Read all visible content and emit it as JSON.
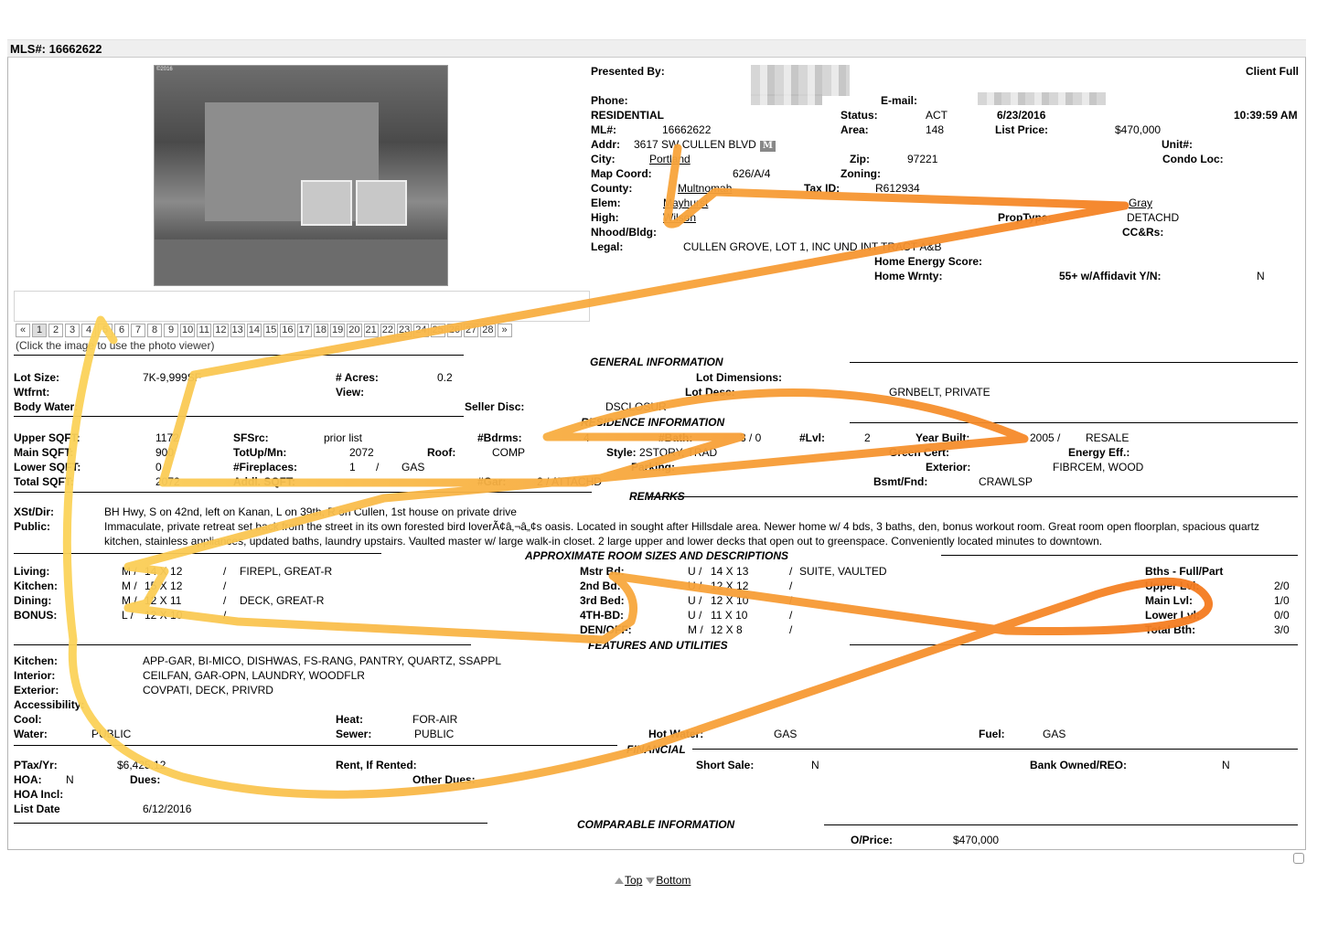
{
  "header": {
    "title": "MLS#: 16662622"
  },
  "photo": {
    "copyright": "©2016",
    "alt": "house-photo"
  },
  "pager": {
    "prev": "«",
    "pages": [
      "1",
      "2",
      "3",
      "4",
      "5",
      "6",
      "7",
      "8",
      "9",
      "10",
      "11",
      "12",
      "13",
      "14",
      "15",
      "16",
      "17",
      "18",
      "19",
      "20",
      "21",
      "22",
      "23",
      "24",
      "25",
      "26",
      "27",
      "28"
    ],
    "next": "»",
    "active": "1",
    "hint": "(Click the image to use the photo viewer)"
  },
  "agent": {
    "presented_by_label": "Presented By:",
    "phone_label": "Phone:",
    "email_label": "E-mail:",
    "report_type": "Client Full"
  },
  "listing": {
    "type": "RESIDENTIAL",
    "status_label": "Status:",
    "status": "ACT",
    "date": "6/23/2016",
    "time": "10:39:59 AM",
    "ml_label": "ML#:",
    "ml": "16662622",
    "area_label": "Area:",
    "area": "148",
    "list_price_label": "List Price:",
    "list_price": "$470,000",
    "addr_label": "Addr:",
    "addr": "3617 SW CULLEN BLVD",
    "map_badge": "M",
    "unit_label": "Unit#:",
    "city_label": "City:",
    "city": "Portland",
    "zip_label": "Zip:",
    "zip": "97221",
    "condo_label": "Condo Loc:",
    "map_coord_label": "Map Coord:",
    "map_coord": "626/A/4",
    "zoning_label": "Zoning:",
    "county_label": "County:",
    "county": "Multnomah",
    "tax_id_label": "Tax ID:",
    "tax_id": "R612934",
    "elem_label": "Elem:",
    "elem": "Mayhurst",
    "middle": "Gray",
    "high_label": "High:",
    "high": "Wilson",
    "proptype_label": "PropType:",
    "proptype": "DETACHD",
    "nhood_label": "Nhood/Bldg:",
    "ccrs_label": "CC&Rs:",
    "legal_label": "Legal:",
    "legal": "CULLEN GROVE, LOT 1, INC UND INT TRACT A&B",
    "energy_label": "Home Energy Score:",
    "wrnty_label": "Home Wrnty:",
    "affidavit_label": "55+ w/Affidavit Y/N:",
    "affidavit": "N"
  },
  "general": {
    "title": "GENERAL INFORMATION",
    "lot_size_label": "Lot Size:",
    "lot_size": "7K-9,999SF",
    "acres_label": "# Acres:",
    "acres": "0.2",
    "lot_dim_label": "Lot Dimensions:",
    "wtfrnt_label": "Wtfrnt:",
    "view_label": "View:",
    "lot_desc_label": "Lot Desc:",
    "lot_desc": "GRNBELT, PRIVATE",
    "body_water_label": "Body Water:",
    "seller_disc_label": "Seller Disc:",
    "seller_disc": "DSCLOSUR"
  },
  "residence": {
    "title": "RESIDENCE INFORMATION",
    "upper_label": "Upper SQFT:",
    "upper": "1172",
    "sfsrc_label": "SFSrc:",
    "sfsrc": "prior list",
    "bdrms_label": "#Bdrms:",
    "bdrms": "4",
    "bath_label": "#Bath:",
    "bath": "3 / 0",
    "lvl_label": "#Lvl:",
    "lvl": "2",
    "year_label": "Year Built:",
    "year": "2005 /",
    "year_type": "RESALE",
    "main_label": "Main SQFT:",
    "main": "900",
    "totupmn_label": "TotUp/Mn:",
    "totupmn": "2072",
    "roof_label": "Roof:",
    "roof": "COMP",
    "style_label": "Style:",
    "style": "2STORY, TRAD",
    "green_label": "Green Cert:",
    "energy_eff_label": "Energy Eff.:",
    "lower_label": "Lower SQFT:",
    "lower": "0",
    "fireplaces_label": "#Fireplaces:",
    "fireplaces": "1",
    "fireplaces_sep": "/",
    "fireplaces_type": "GAS",
    "parking_label": "Parking:",
    "exterior_label": "Exterior:",
    "exterior": "FIBRCEM, WOOD",
    "total_label": "Total SQFT:",
    "total": "2072",
    "addl_label": "Addl. SQFT:",
    "gar_label": "#Gar:",
    "gar": "2 / ATTACHD",
    "bsmt_label": "Bsmt/Fnd:",
    "bsmt": "CRAWLSP"
  },
  "remarks": {
    "title": "REMARKS",
    "xst_label": "XSt/Dir:",
    "xst": "BH Hwy, S on 42nd, left on Kanan, L on 39th, R on Cullen, 1st house on private drive",
    "public_label": "Public:",
    "public_line1": "Immaculate, private retreat set back from the street in its own forested bird loverÃ¢â‚¬â„¢s oasis. Located in sought after Hillsdale area. Newer home w/ 4 bds, 3 baths, den, bonus workout room. Great room open floorplan, spacious quartz",
    "public_line2": "kitchen, stainless appliances, updated baths, laundry upstairs. Vaulted master w/ large walk-in closet. 2 large upper and lower decks that open out to greenspace. Conveniently located minutes to downtown."
  },
  "rooms": {
    "title": "APPROXIMATE ROOM SIZES AND DESCRIPTIONS",
    "left": [
      {
        "name": "Living:",
        "lvl": "M /",
        "size": "14 X 12",
        "sep": "/",
        "desc": "FIREPL, GREAT-R"
      },
      {
        "name": "Kitchen:",
        "lvl": "M /",
        "size": "15 X 12",
        "sep": "/",
        "desc": ""
      },
      {
        "name": "Dining:",
        "lvl": "M /",
        "size": "12 X 11",
        "sep": "/",
        "desc": "DECK, GREAT-R"
      },
      {
        "name": "BONUS:",
        "lvl": "L /",
        "size": "12 X 10",
        "sep": "/",
        "desc": ""
      }
    ],
    "right": [
      {
        "name": "Mstr Bd:",
        "lvl": "U /",
        "size": "14 X 13",
        "sep": "/",
        "desc": "SUITE, VAULTED"
      },
      {
        "name": "2nd Bd:",
        "lvl": "U /",
        "size": "12 X 12",
        "sep": "/",
        "desc": ""
      },
      {
        "name": "3rd Bed:",
        "lvl": "U /",
        "size": "12 X 10",
        "sep": "/",
        "desc": ""
      },
      {
        "name": "4TH-BD:",
        "lvl": "U /",
        "size": "11 X 10",
        "sep": "/",
        "desc": ""
      },
      {
        "name": "DEN/OFF:",
        "lvl": "M /",
        "size": "12 X 8",
        "sep": "/",
        "desc": ""
      }
    ],
    "baths_title": "Bths - Full/Part",
    "baths": [
      {
        "name": "Upper Lvl:",
        "val": "2/0"
      },
      {
        "name": "Main Lvl:",
        "val": "1/0"
      },
      {
        "name": "Lower Lvl:",
        "val": "0/0"
      },
      {
        "name": "Total Bth:",
        "val": "3/0"
      }
    ]
  },
  "features": {
    "title": "FEATURES AND UTILITIES",
    "kitchen_label": "Kitchen:",
    "kitchen": "APP-GAR, BI-MICO, DISHWAS, FS-RANG, PANTRY, QUARTZ, SSAPPL",
    "interior_label": "Interior:",
    "interior": "CEILFAN, GAR-OPN, LAUNDRY, WOODFLR",
    "exterior_label": "Exterior:",
    "exterior": "COVPATI, DECK, PRIVRD",
    "access_label": "Accessibility:",
    "cool_label": "Cool:",
    "heat_label": "Heat:",
    "heat": "FOR-AIR",
    "water_label": "Water:",
    "water": "PUBLIC",
    "sewer_label": "Sewer:",
    "sewer": "PUBLIC",
    "hotwater_label": "Hot Water:",
    "hotwater": "GAS",
    "fuel_label": "Fuel:",
    "fuel": "GAS"
  },
  "financial": {
    "title": "FINANCIAL",
    "ptax_label": "PTax/Yr:",
    "ptax": "$6,425.12",
    "rent_label": "Rent, If Rented:",
    "short_sale_label": "Short Sale:",
    "short_sale": "N",
    "reo_label": "Bank Owned/REO:",
    "reo": "N",
    "hoa_label": "HOA:",
    "hoa": "N",
    "dues_label": "Dues:",
    "other_dues_label": "Other Dues:",
    "hoa_incl_label": "HOA Incl:",
    "list_date_label": "List Date",
    "list_date": "6/12/2016"
  },
  "comparable": {
    "title": "COMPARABLE INFORMATION",
    "oprice_label": "O/Price:",
    "oprice": "$470,000"
  },
  "footer": {
    "top": "Top",
    "bottom": "Bottom"
  },
  "annotation": {
    "stroke_start": "#fbd35a",
    "stroke_end": "#f47a1f"
  }
}
